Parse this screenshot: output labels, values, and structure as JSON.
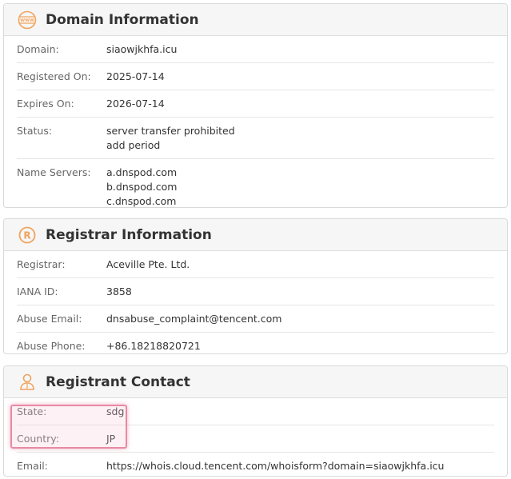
{
  "domain_info": {
    "title": "Domain Information",
    "icon": "www-icon",
    "rows": [
      {
        "label": "Domain:",
        "values": [
          "siaowjkhfa.icu"
        ]
      },
      {
        "label": "Registered On:",
        "values": [
          "2025-07-14"
        ]
      },
      {
        "label": "Expires On:",
        "values": [
          "2026-07-14"
        ]
      },
      {
        "label": "Status:",
        "values": [
          "server transfer prohibited",
          "add period"
        ]
      },
      {
        "label": "Name Servers:",
        "values": [
          "a.dnspod.com",
          "b.dnspod.com",
          "c.dnspod.com"
        ]
      }
    ]
  },
  "registrar_info": {
    "title": "Registrar Information",
    "icon": "registered-icon",
    "rows": [
      {
        "label": "Registrar:",
        "values": [
          "Aceville Pte. Ltd."
        ]
      },
      {
        "label": "IANA ID:",
        "values": [
          "3858"
        ]
      },
      {
        "label": "Abuse Email:",
        "values": [
          "dnsabuse_complaint@tencent.com"
        ]
      },
      {
        "label": "Abuse Phone:",
        "values": [
          "+86.18218820721"
        ]
      }
    ]
  },
  "registrant_contact": {
    "title": "Registrant Contact",
    "icon": "person-icon",
    "rows": [
      {
        "label": "State:",
        "values": [
          "sdg"
        ]
      },
      {
        "label": "Country:",
        "values": [
          "JP"
        ]
      },
      {
        "label": "Email:",
        "values": [
          "https://whois.cloud.tencent.com/whoisform?domain=siaowjkhfa.icu"
        ]
      }
    ]
  },
  "colors": {
    "icon_accent": "#f0a35e",
    "highlight_border": "#e88aa4"
  }
}
